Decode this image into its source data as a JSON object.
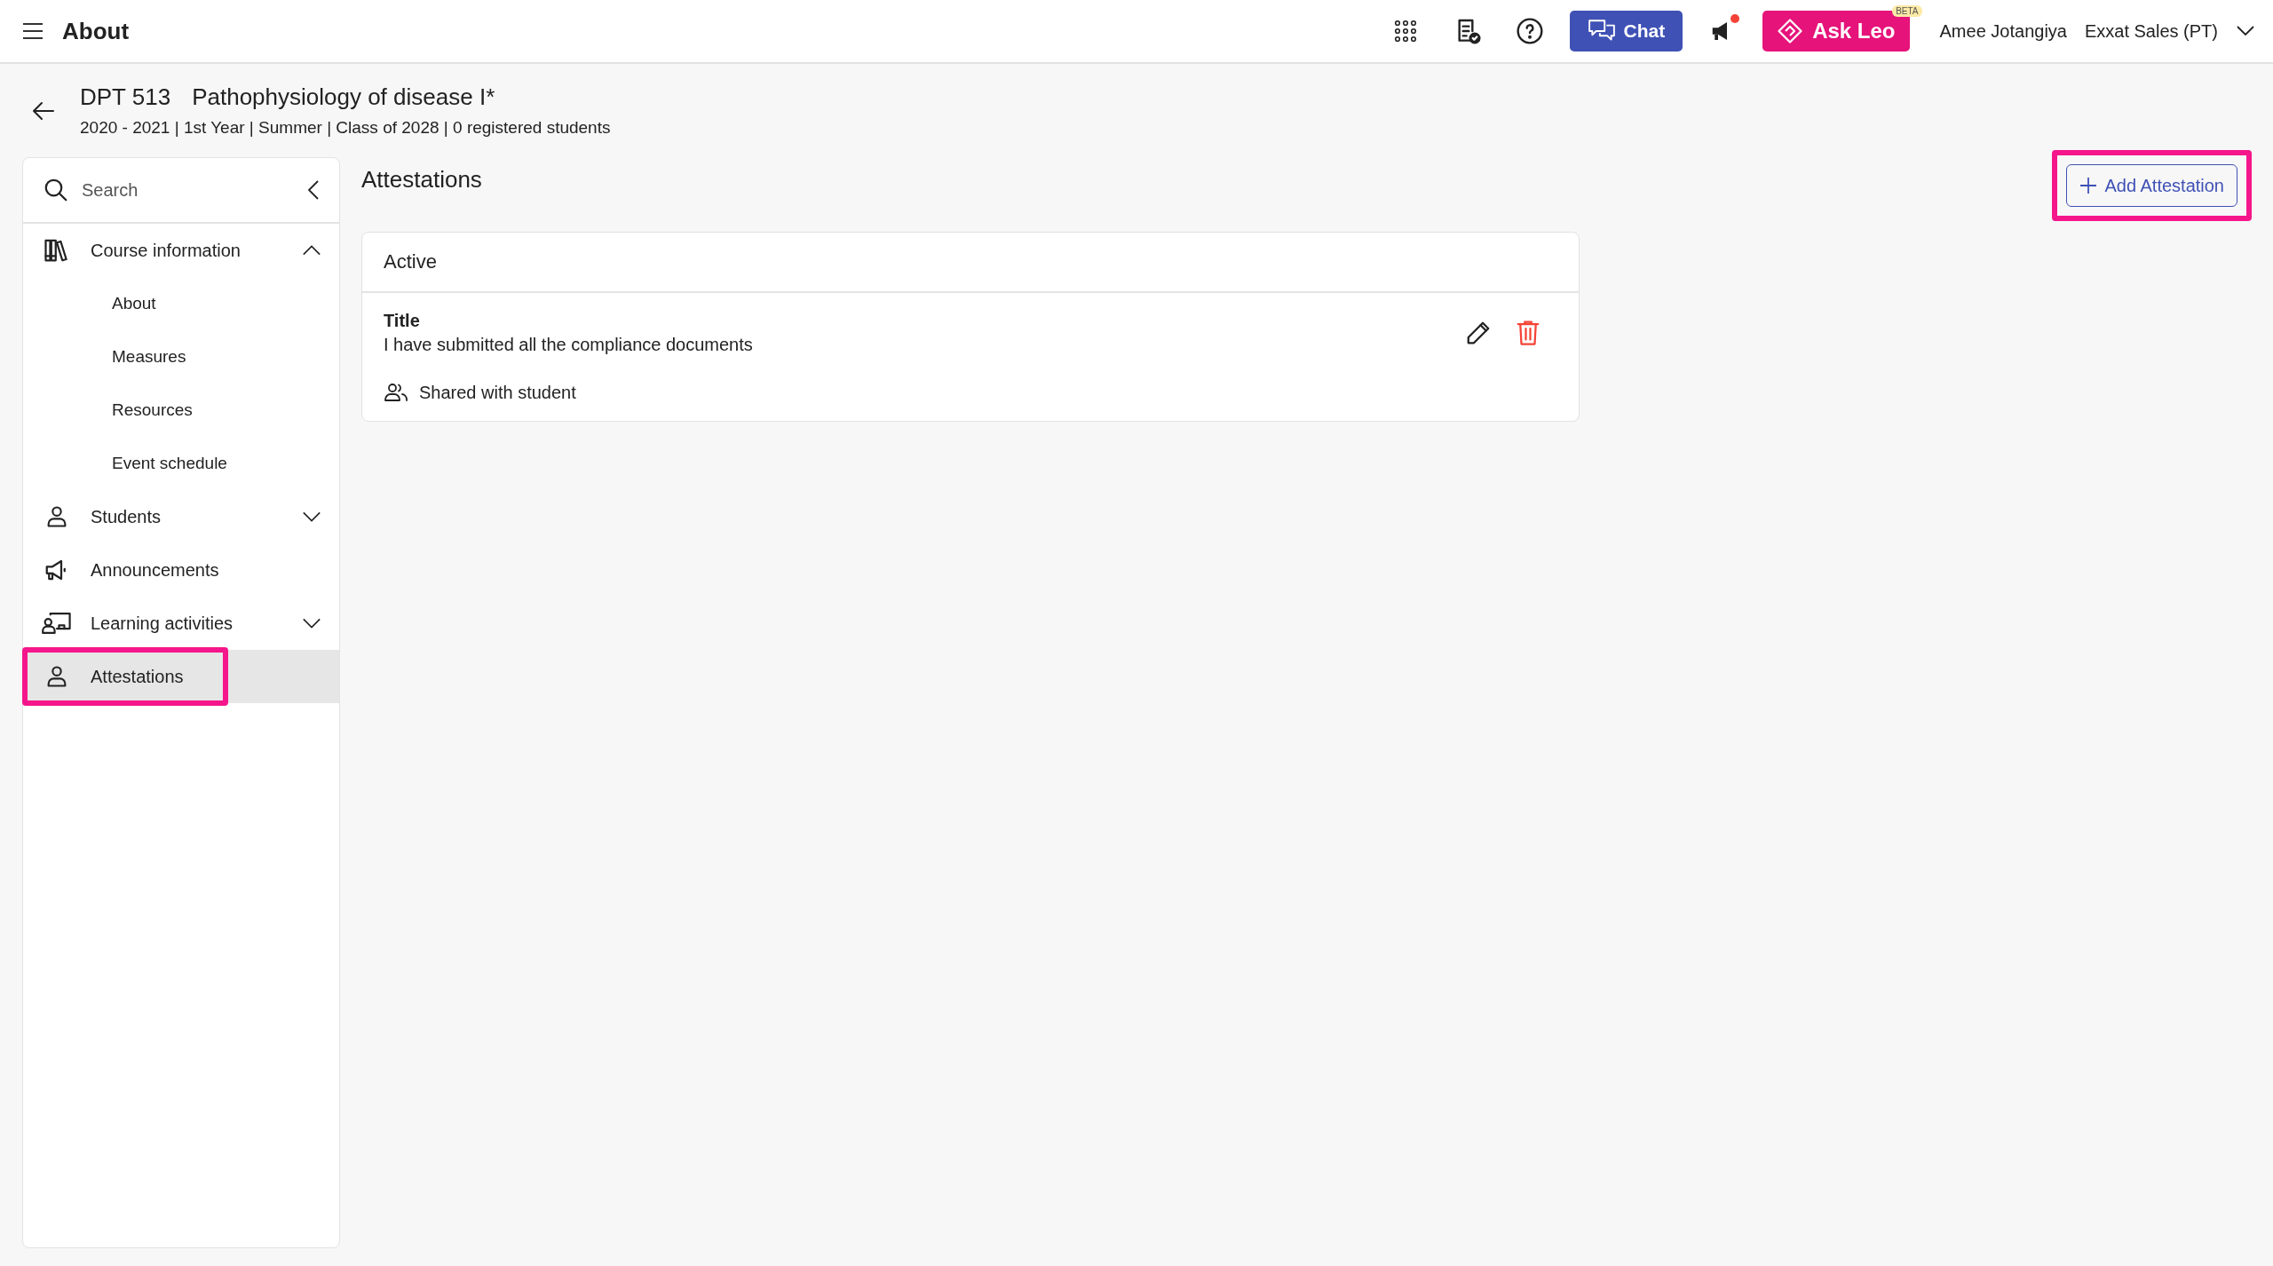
{
  "topbar": {
    "page_title": "About",
    "chat_label": "Chat",
    "notifications_unread": true,
    "ask_leo_label": "Ask Leo",
    "ask_leo_badge": "BETA",
    "user_name": "Amee Jotangiya",
    "organization": "Exxat Sales (PT)"
  },
  "course": {
    "code": "DPT 513",
    "name": "Pathophysiology of disease I*",
    "details": "2020 - 2021 | 1st Year | Summer | Class of 2028 | 0 registered students"
  },
  "sidebar": {
    "search": {
      "placeholder": "Search"
    },
    "items": [
      {
        "label": "Course information",
        "expandable": true,
        "expanded": true,
        "selected": false,
        "highlighted": false,
        "children": [
          {
            "label": "About",
            "selected": false
          },
          {
            "label": "Measures",
            "selected": false
          },
          {
            "label": "Resources",
            "selected": false
          },
          {
            "label": "Event schedule",
            "selected": false
          }
        ]
      },
      {
        "label": "Students",
        "expandable": true,
        "expanded": false,
        "selected": false,
        "highlighted": false
      },
      {
        "label": "Announcements",
        "expandable": false,
        "selected": false,
        "highlighted": false
      },
      {
        "label": "Learning activities",
        "expandable": true,
        "expanded": false,
        "selected": false,
        "highlighted": false
      },
      {
        "label": "Attestations",
        "expandable": false,
        "selected": true,
        "highlighted": true
      }
    ]
  },
  "main": {
    "title": "Attestations",
    "add_button": {
      "label": "Add Attestation",
      "highlighted": true
    },
    "sections": [
      {
        "heading": "Active",
        "items": [
          {
            "field_label": "Title",
            "value": "I have submitted all the compliance documents",
            "sharing": "Shared with student"
          }
        ]
      }
    ]
  }
}
